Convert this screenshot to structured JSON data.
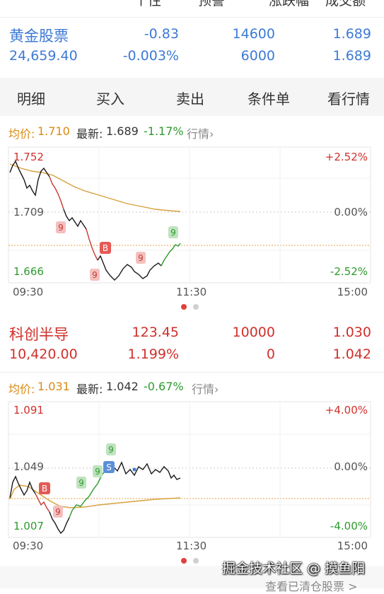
{
  "top_partial": {
    "text": [
      "个性",
      "预警",
      "涨跌幅",
      "成交额"
    ]
  },
  "stock1": {
    "name": "黄金股票",
    "price": "24,659.40",
    "change": "-0.83",
    "change_pct": "-0.003%",
    "vol1": "14600",
    "vol2": "6000",
    "p1": "1.689",
    "p2": "1.689"
  },
  "tabs": [
    "明细",
    "买入",
    "卖出",
    "条件单",
    "看行情"
  ],
  "info1": {
    "avg_label": "均价:",
    "avg": "1.710",
    "latest_label": "最新:",
    "latest": "1.689",
    "pct": "-1.17%",
    "more": "行情"
  },
  "chart1": {
    "y_high": "1.752",
    "y_mid": "1.709",
    "y_low": "1.666",
    "pct_high": "+2.52%",
    "pct_mid": "0.00%",
    "pct_low": "-2.52%",
    "t_start": "09:30",
    "t_mid": "11:30",
    "t_end": "15:00",
    "markers": [
      "9",
      "B",
      "9",
      "9",
      "9"
    ]
  },
  "stock2": {
    "name": "科创半导",
    "price": "10,420.00",
    "change": "123.45",
    "change_pct": "1.199%",
    "vol1": "10000",
    "vol2": "0",
    "p1": "1.030",
    "p2": "1.042"
  },
  "info2": {
    "avg_label": "均价:",
    "avg": "1.031",
    "latest_label": "最新:",
    "latest": "1.042",
    "pct": "-0.67%",
    "more": "行情"
  },
  "chart2": {
    "y_high": "1.091",
    "y_mid": "1.049",
    "y_low": "1.007",
    "pct_high": "+4.00%",
    "pct_mid": "0.00%",
    "pct_low": "-4.00%",
    "t_start": "09:30",
    "t_mid": "11:30",
    "t_end": "15:00",
    "markers": [
      "B",
      "9",
      "9",
      "9",
      "9",
      "S"
    ]
  },
  "watermark": "掘金技术社区 @ 摸鱼阳",
  "view_cleared": "查看已清仓股票 >",
  "colors": {
    "up": "#d0302b",
    "down": "#2e9a2e",
    "avg": "#d98a12",
    "link": "#3d7ad6"
  }
}
